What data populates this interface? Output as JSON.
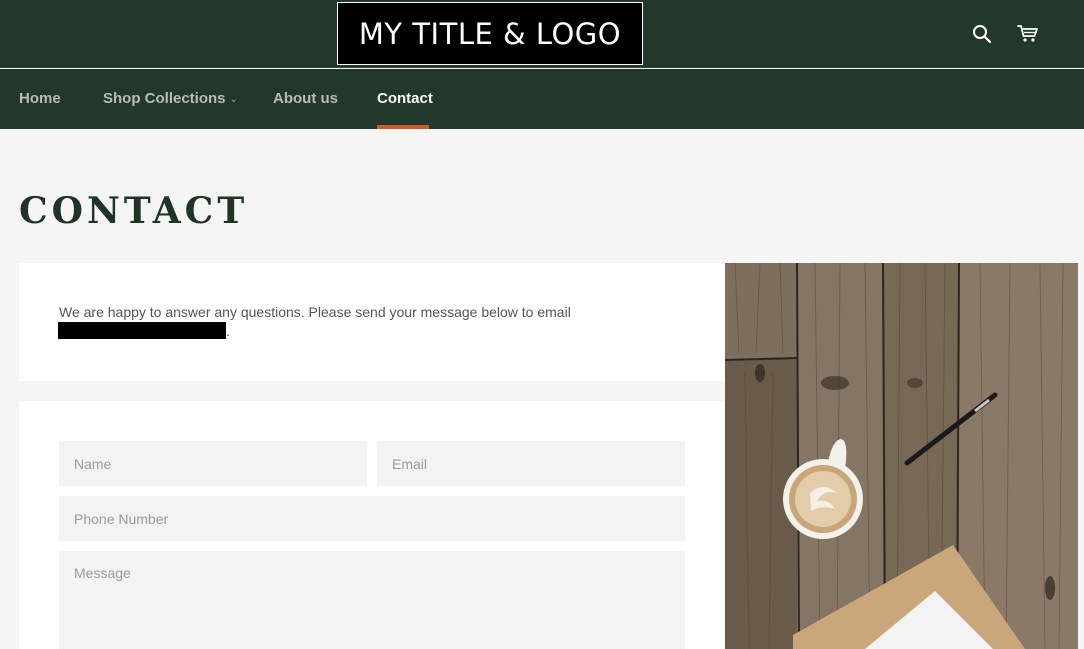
{
  "header": {
    "logo_text": "MY TITLE & LOGO",
    "icons": [
      "search-icon",
      "cart-icon"
    ],
    "background_color": "#22382b"
  },
  "nav": {
    "items": [
      {
        "label": "Home"
      },
      {
        "label": "Shop Collections"
      },
      {
        "label": "About us"
      },
      {
        "label": "Contact"
      }
    ],
    "active": "Contact",
    "active_underline_color": "#d05a25"
  },
  "main": {
    "title": "CONTACT",
    "intro_text": "We are happy to answer any questions. Please send your message below to email",
    "intro_trailing": "."
  },
  "form": {
    "name_placeholder": "Name",
    "email_placeholder": "Email",
    "phone_placeholder": "Phone Number",
    "message_placeholder": "Message"
  }
}
